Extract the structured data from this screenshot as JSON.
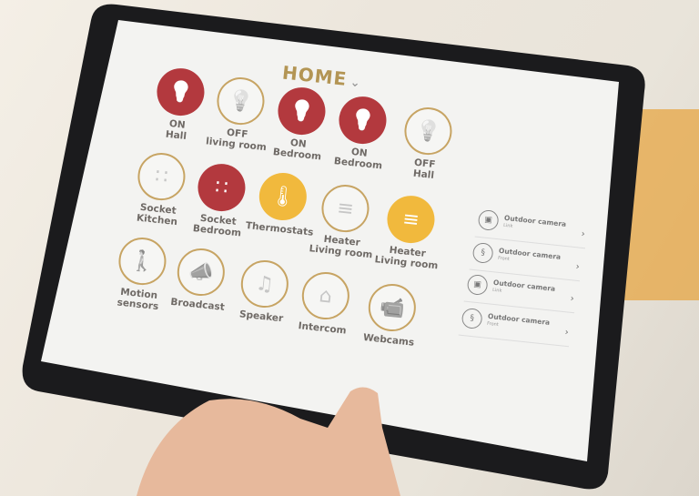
{
  "header": {
    "title": "HOME",
    "chevron": "chevron-down-icon"
  },
  "colors": {
    "on": "#b3393e",
    "off_border": "#c7a463",
    "accent_yellow": "#f1b93d",
    "title": "#b39554"
  },
  "devices": [
    {
      "icon": "lightbulb-icon",
      "state": "on",
      "lines": [
        "ON",
        "Hall"
      ]
    },
    {
      "icon": "lightbulb-icon",
      "state": "off",
      "lines": [
        "OFF",
        "living room"
      ]
    },
    {
      "icon": "lightbulb-icon",
      "state": "on",
      "lines": [
        "ON",
        "Bedroom"
      ]
    },
    {
      "icon": "lightbulb-icon",
      "state": "on",
      "lines": [
        "ON",
        "Bedroom"
      ]
    },
    {
      "icon": "lightbulb-icon",
      "state": "off",
      "lines": [
        "OFF",
        "Hall"
      ]
    },
    {
      "icon": "socket-icon",
      "state": "off",
      "lines": [
        "Socket",
        "Kitchen"
      ]
    },
    {
      "icon": "socket-icon",
      "state": "on",
      "lines": [
        "Socket",
        "Bedroom"
      ]
    },
    {
      "icon": "thermometer-icon",
      "state": "yellow",
      "lines": [
        "Thermostats"
      ]
    },
    {
      "icon": "heater-icon",
      "state": "off",
      "lines": [
        "Heater",
        "Living room"
      ]
    },
    {
      "icon": "heater-icon",
      "state": "yellow",
      "lines": [
        "Heater",
        "Living room"
      ]
    },
    {
      "icon": "motion-sensor-icon",
      "state": "off",
      "lines": [
        "Motion",
        "sensors"
      ]
    },
    {
      "icon": "broadcast-icon",
      "state": "off",
      "lines": [
        "Broadcast"
      ]
    },
    {
      "icon": "music-note-icon",
      "state": "off",
      "lines": [
        "Speaker"
      ]
    },
    {
      "icon": "intercom-icon",
      "state": "off",
      "lines": [
        "Intercom"
      ]
    },
    {
      "icon": "webcam-icon",
      "state": "off",
      "lines": [
        "Webcams"
      ]
    }
  ],
  "cameras": [
    {
      "name": "Outdoor camera",
      "sub": "Link",
      "icon": "cctv-camera-icon"
    },
    {
      "name": "Outdoor camera",
      "sub": "Front",
      "icon": "sensor-icon"
    },
    {
      "name": "Outdoor camera",
      "sub": "Link",
      "icon": "cctv-camera-icon"
    },
    {
      "name": "Outdoor camera",
      "sub": "Front",
      "icon": "sensor-icon"
    }
  ]
}
